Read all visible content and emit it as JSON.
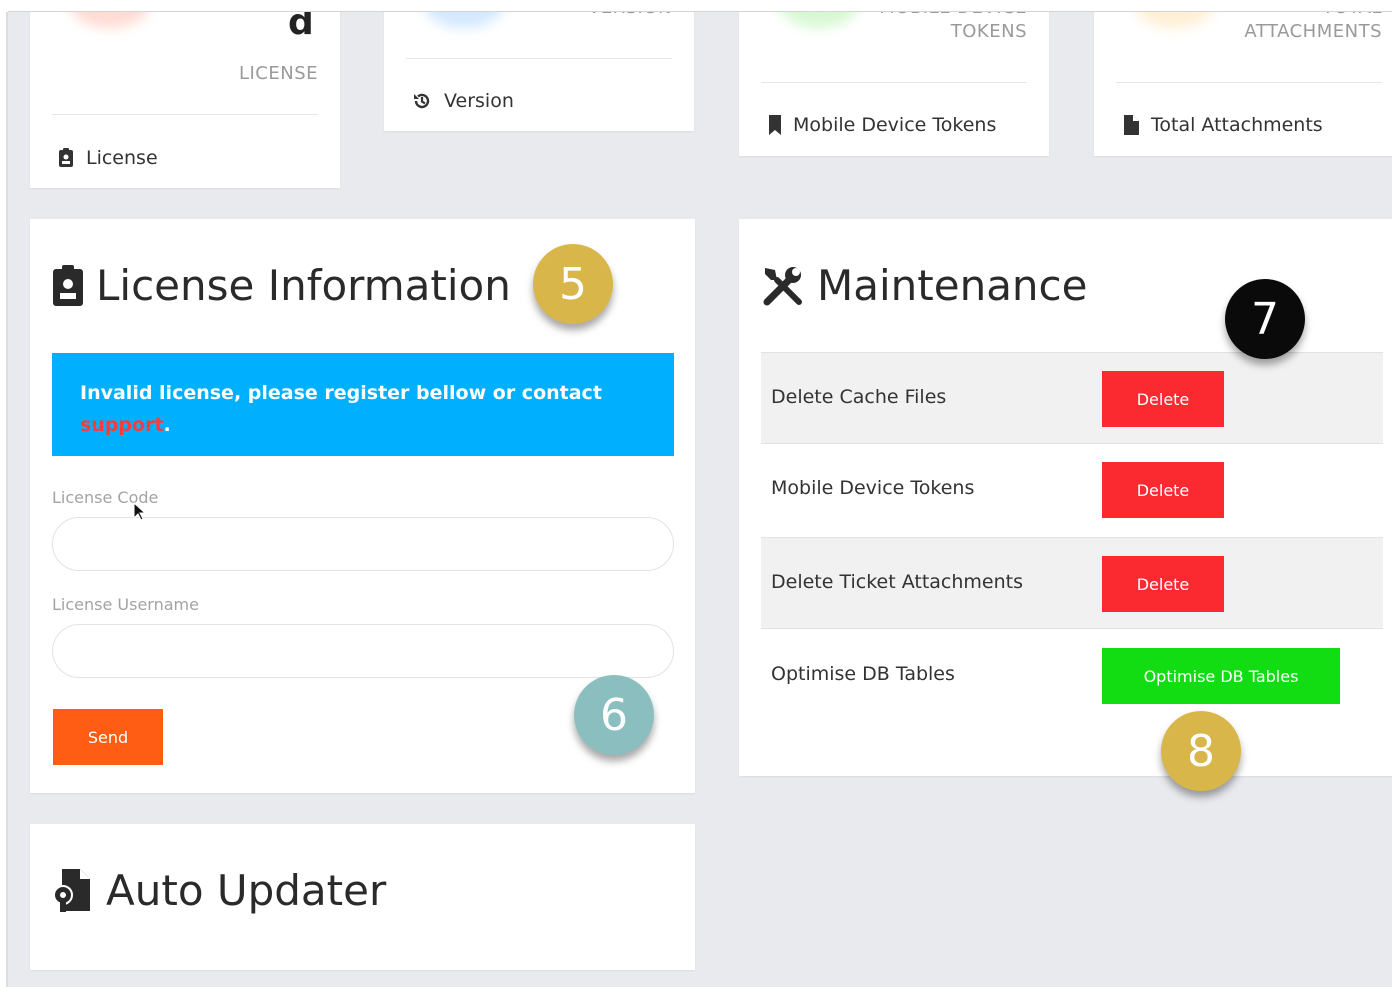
{
  "stats": [
    {
      "partial": "d",
      "label": "LICENSE",
      "footer": "License",
      "footer_icon": "id-badge-icon",
      "blob_color": "#ffb0a0"
    },
    {
      "label": "VERSION",
      "footer": "Version",
      "footer_icon": "history-icon",
      "blob_color": "#9ecbff"
    },
    {
      "label_line1": "MOBILE DEVICE",
      "label_line2": "TOKENS",
      "footer": "Mobile Device Tokens",
      "footer_icon": "bookmark-icon",
      "blob_color": "#a8ef9e"
    },
    {
      "label_line1": "TOTAL",
      "label_line2": "ATTACHMENTS",
      "footer": "Total Attachments",
      "footer_icon": "file-icon",
      "blob_color": "#ffdca0"
    }
  ],
  "license_panel": {
    "title": "License Information",
    "alert_text": "Invalid license, please register bellow or contact",
    "alert_link": "support",
    "alert_end": ".",
    "code_label": "License Code",
    "code_value": "",
    "username_label": "License Username",
    "username_value": "",
    "send_label": "Send"
  },
  "maintenance": {
    "title": "Maintenance",
    "rows": [
      {
        "label": "Delete Cache Files",
        "button": "Delete"
      },
      {
        "label": "Mobile Device Tokens",
        "button": "Delete"
      },
      {
        "label": "Delete Ticket Attachments",
        "button": "Delete"
      },
      {
        "label": "Optimise DB Tables",
        "button": "Optimise DB Tables"
      }
    ]
  },
  "auto_updater": {
    "title": "Auto Updater"
  },
  "badges": [
    {
      "num": "5",
      "color": "#d9b64a"
    },
    {
      "num": "6",
      "color": "#8bbfbf"
    },
    {
      "num": "7",
      "color": "#0a0a0a"
    },
    {
      "num": "8",
      "color": "#d9b64a"
    }
  ],
  "colors": {
    "alert": "#00b0ff",
    "send": "#ff5c14",
    "delete": "#fb2a31",
    "optimise": "#12dd12",
    "background": "#e9eaee"
  }
}
